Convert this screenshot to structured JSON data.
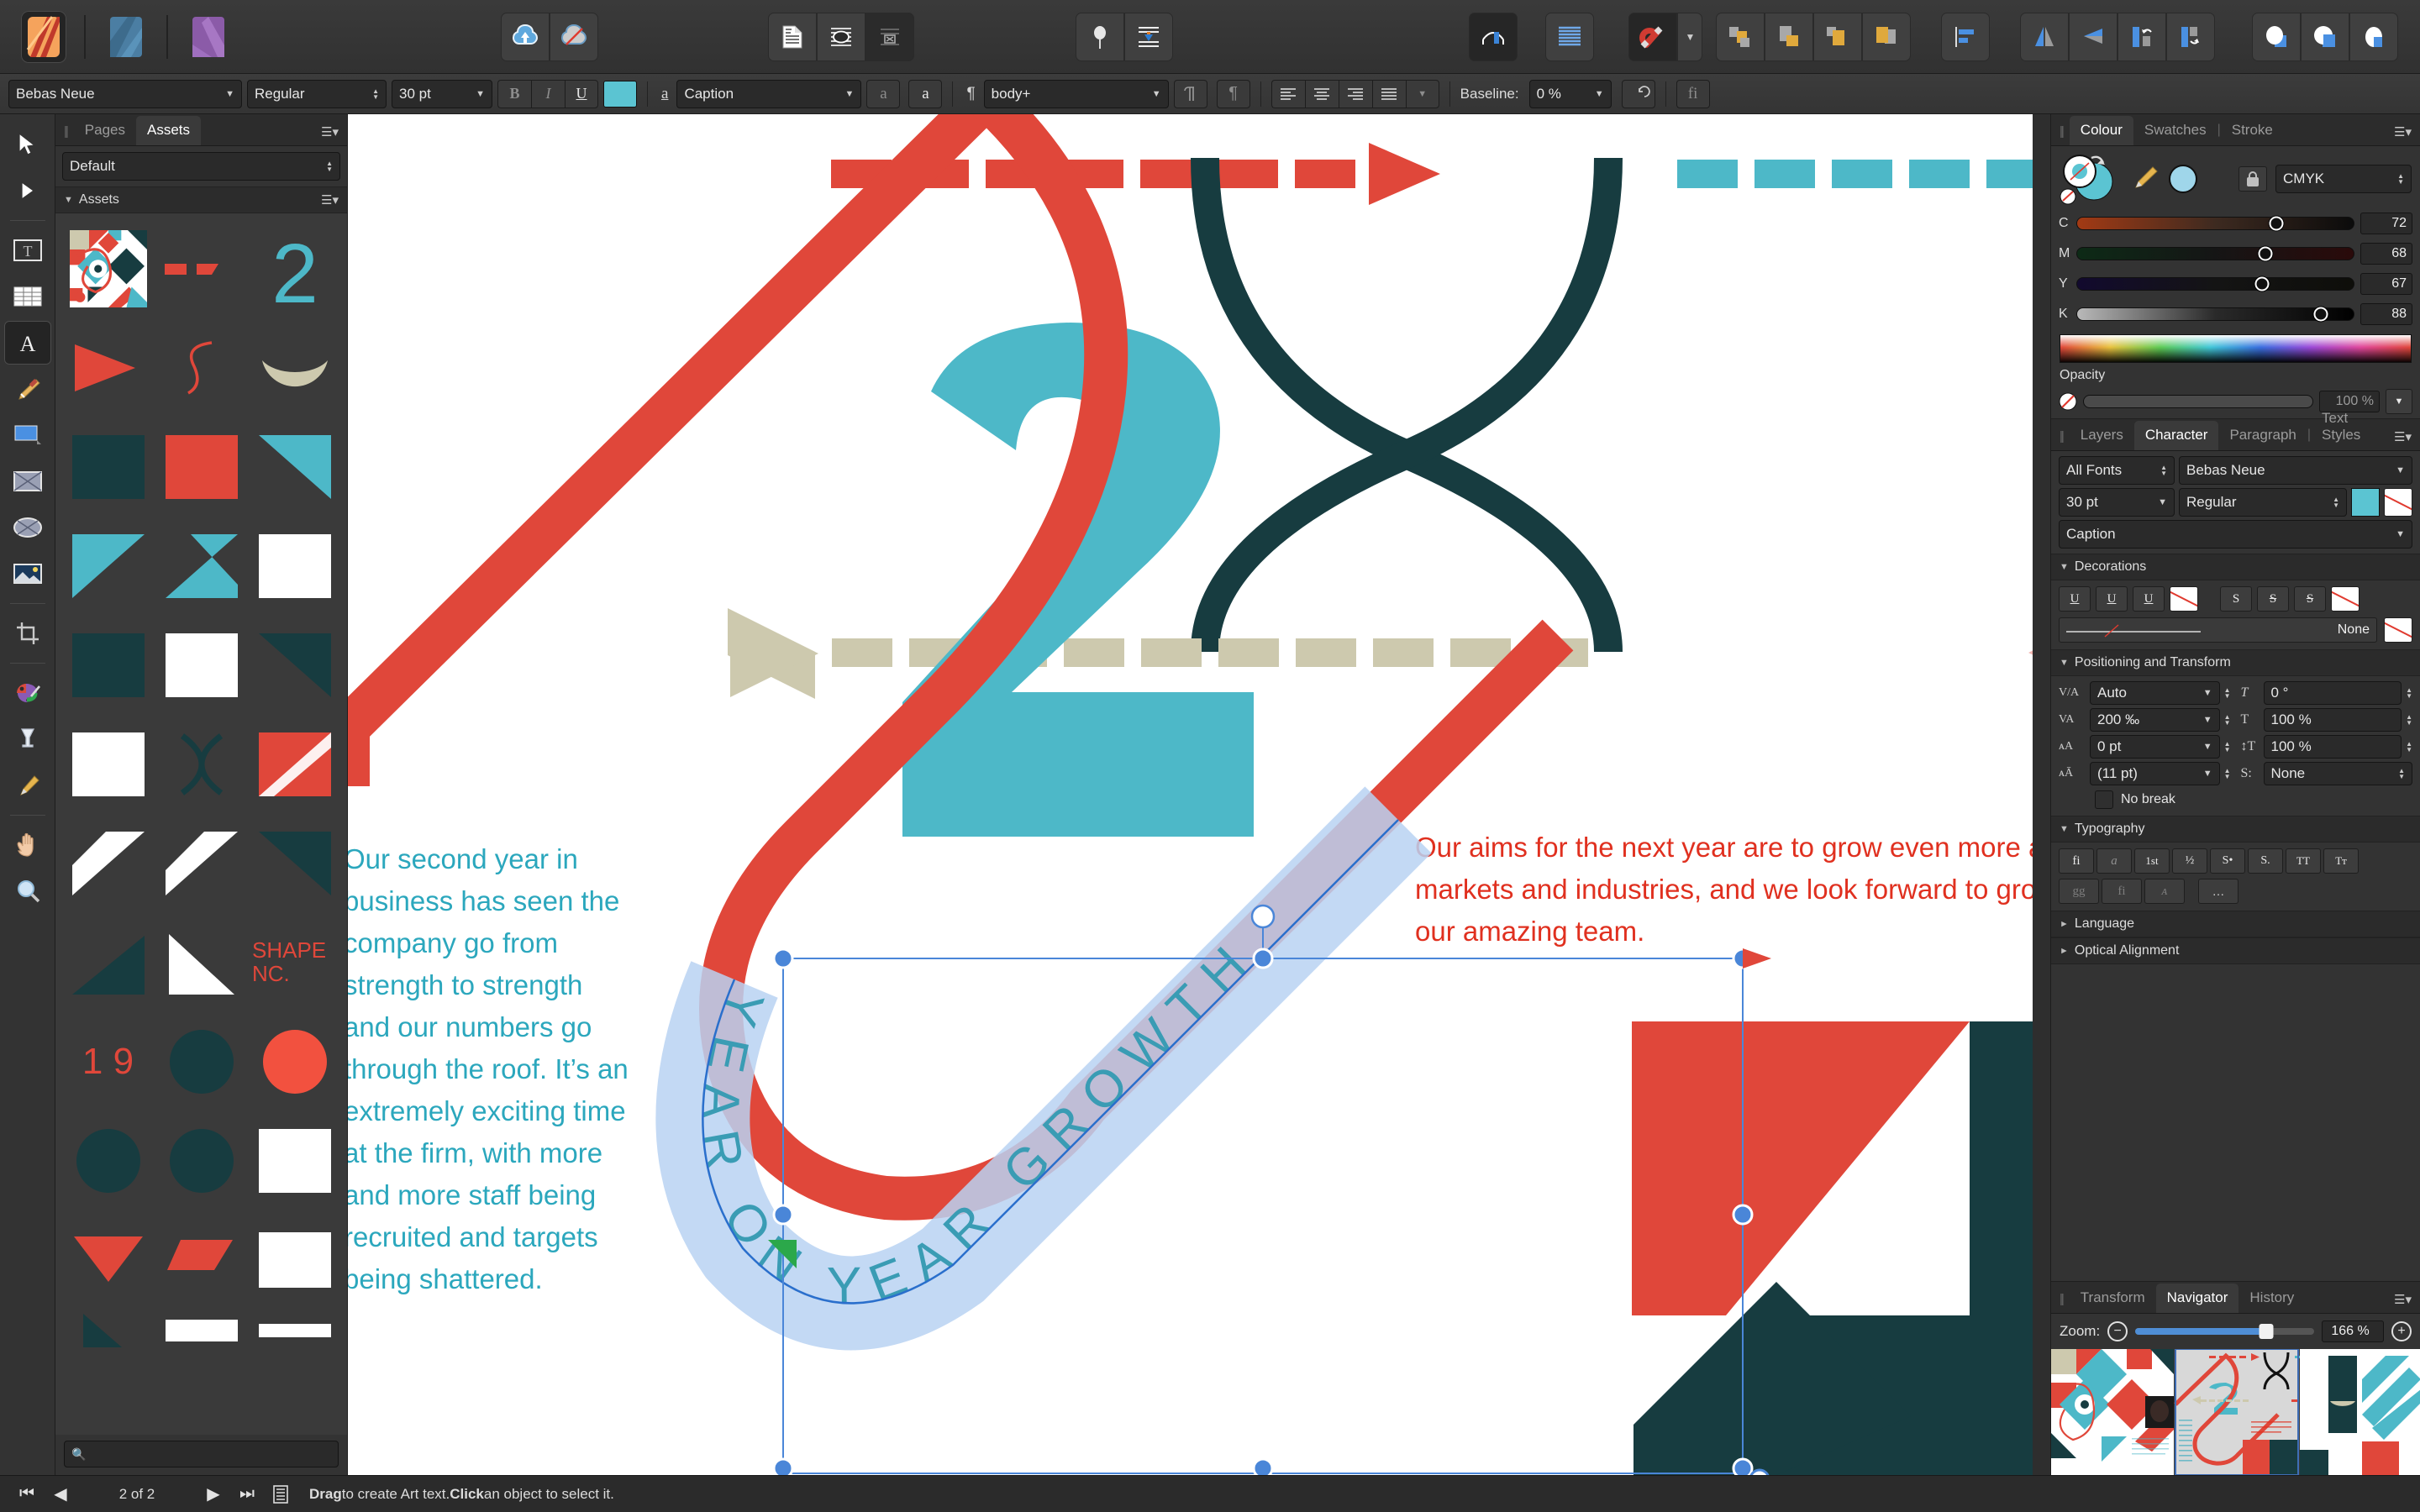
{
  "app": {
    "name": "Affinity Publisher",
    "apps": [
      "publisher-icon",
      "designer-icon",
      "photo-icon"
    ]
  },
  "toolbar": {
    "persona_labels": [
      "publisher-persona",
      "designer-persona",
      "photo-persona"
    ],
    "buttons": [
      {
        "name": "upload-to-cloud",
        "label": "Upload"
      },
      {
        "name": "cloud-disabled",
        "label": "No Cloud"
      },
      {
        "name": "document-setup",
        "label": "Document Setup"
      },
      {
        "name": "preflight",
        "label": "Preflight"
      },
      {
        "name": "stock",
        "label": "Stock"
      },
      {
        "name": "pin-to-text",
        "label": "Pin"
      },
      {
        "name": "text-frame",
        "label": "Text Frame"
      },
      {
        "name": "show-guides",
        "label": "Guides"
      },
      {
        "name": "text-wrap",
        "label": "Text Wrap"
      },
      {
        "name": "snapping",
        "label": "Snapping"
      },
      {
        "name": "move-back-one",
        "label": "Back One"
      },
      {
        "name": "move-to-back",
        "label": "To Back"
      },
      {
        "name": "move-forward-one",
        "label": "Forward One"
      },
      {
        "name": "move-to-front",
        "label": "To Front"
      },
      {
        "name": "alignment",
        "label": "Alignment"
      },
      {
        "name": "flip-horizontal",
        "label": "Flip Horizontal"
      },
      {
        "name": "flip-vertical",
        "label": "Flip Vertical"
      },
      {
        "name": "rotate-left",
        "label": "Rotate Left"
      },
      {
        "name": "rotate-right",
        "label": "Rotate Right"
      },
      {
        "name": "geometry-add",
        "label": "Add"
      },
      {
        "name": "geometry-subtract",
        "label": "Subtract"
      },
      {
        "name": "geometry-intersect",
        "label": "Intersect"
      }
    ]
  },
  "context_bar": {
    "font_family": "Bebas Neue",
    "font_style": "Regular",
    "font_size": "30 pt",
    "bold": "B",
    "italic": "I",
    "underline": "U",
    "text_color": "#5bc4d2",
    "character_style": "Caption",
    "paragraph_style": "body+",
    "baseline_label": "Baseline:",
    "baseline_value": "0 %",
    "glyph_small": "a",
    "glyph_caps": "a",
    "ligature_btn": "fi",
    "pilcrow": "¶"
  },
  "tools": [
    {
      "name": "move-tool",
      "label": "Move"
    },
    {
      "name": "node-tool",
      "label": "Node"
    },
    {
      "name": "frame-text-tool",
      "label": "Frame Text"
    },
    {
      "name": "table-tool",
      "label": "Table"
    },
    {
      "name": "art-text-tool",
      "label": "Art Text"
    },
    {
      "name": "pen-tool",
      "label": "Pen"
    },
    {
      "name": "rectangle-tool",
      "label": "Rectangle"
    },
    {
      "name": "picture-frame-rect-tool",
      "label": "Picture Frame Rectangle"
    },
    {
      "name": "picture-frame-ellipse-tool",
      "label": "Picture Frame Ellipse"
    },
    {
      "name": "place-image-tool",
      "label": "Place Image"
    },
    {
      "name": "crop-tool",
      "label": "Crop"
    },
    {
      "name": "fill-tool",
      "label": "Fill"
    },
    {
      "name": "transparency-tool",
      "label": "Transparency"
    },
    {
      "name": "colour-picker-tool",
      "label": "Colour Picker"
    },
    {
      "name": "view-pan-tool",
      "label": "View"
    },
    {
      "name": "zoom-tool",
      "label": "Zoom"
    }
  ],
  "assets_panel": {
    "tabs": [
      "Pages",
      "Assets"
    ],
    "active_tab": "Assets",
    "category": "Default",
    "section_title": "Assets",
    "search_placeholder": "",
    "items": [
      "pattern-thumbnail",
      "dash-pair-red",
      "numeral-2-teal",
      "triangle-right-red",
      "squiggle-red",
      "crescent-beige",
      "square-teal-dark",
      "square-red",
      "triangle-corner-teal",
      "triangle-teal-left",
      "triangle-teal-right",
      "square-white",
      "square-teal-dark-2",
      "square-white-2",
      "triangle-dark-2",
      "square-white-3",
      "lens-shape-dark",
      "diagonal-red",
      "triangle-white-diag",
      "triangle-white-diag-2",
      "triangle-dark-3",
      "triangle-dark-4",
      "triangle-white-4",
      "text-shape-nc",
      "numerals-1-9",
      "circle-dark",
      "circle-red",
      "circle-dark-2",
      "circle-dark-3",
      "square-white-4",
      "triangle-red-down",
      "parallelogram-red",
      "square-white-5",
      "triangle-teal-small",
      "bar-white",
      "bar-white-2"
    ],
    "shape_text": "SHAPE NC.",
    "numerals_text": "1 9"
  },
  "document": {
    "left_paragraph": "Our second year in business has seen the company go from strength to strength and our numbers go through the roof. It’s an extremely exciting time at the firm, with more and more staff being recruited and targets being shattered.",
    "right_paragraph": "Our aims for the next year are to grow even more and other markets and industries, and we look forward to ground with our amazing team.",
    "art_text": "YEAR ON YEAR GROWTH",
    "numeral_big": "2"
  },
  "colour_panel": {
    "tabs": [
      "Colour",
      "Swatches",
      "Stroke"
    ],
    "active_tab": "Colour",
    "lock_icon": "lock-icon",
    "model": "CMYK",
    "channels": [
      {
        "label": "C",
        "value": "72"
      },
      {
        "label": "M",
        "value": "68"
      },
      {
        "label": "Y",
        "value": "67"
      },
      {
        "label": "K",
        "value": "88"
      }
    ],
    "opacity_label": "Opacity",
    "opacity_value": "100 %"
  },
  "character_panel": {
    "tabs": [
      "Layers",
      "Character",
      "Paragraph",
      "Text Styles"
    ],
    "active_tab": "Character",
    "font_filter": "All Fonts",
    "font_family": "Bebas Neue",
    "font_size": "30 pt",
    "font_style": "Regular",
    "fill_color": "#5bc4d2",
    "stroke_color": "none",
    "text_style": "Caption",
    "decorations": {
      "title": "Decorations",
      "underline_buttons": [
        "U",
        "U",
        "U"
      ],
      "strike_buttons": [
        "S",
        "S",
        "S"
      ],
      "line_value": "None"
    },
    "positioning": {
      "title": "Positioning and Transform",
      "kerning_icon": "V/A",
      "kerning": "Auto",
      "tracking_icon": "VA",
      "tracking": "200 ‰",
      "baseline_icon": "A-baseline",
      "baseline": "0 pt",
      "leading_icon": "A-leading",
      "leading": "(11 pt)",
      "rotation_icon": "T",
      "rotation": "0 °",
      "hscale_icon": "T-horizontal",
      "hscale": "100 %",
      "vscale_icon": "T-vertical",
      "vscale": "100 %",
      "script_label": "S:",
      "script": "None",
      "no_break": "No break"
    },
    "typography": {
      "title": "Typography",
      "buttons": [
        "fi",
        "a",
        "1st",
        "½",
        "S•",
        "S.",
        "TT",
        "Tᴛ"
      ],
      "buttons2": [
        "gg",
        "fi",
        "ᴀ",
        "…"
      ]
    },
    "language": "Language",
    "optical_alignment": "Optical Alignment"
  },
  "navigator_panel": {
    "tabs": [
      "Transform",
      "Navigator",
      "History"
    ],
    "active_tab": "Navigator",
    "zoom_label": "Zoom:",
    "zoom_value": "166 %",
    "minus": "−",
    "plus": "+"
  },
  "status_bar": {
    "page_indicator": "2 of 2",
    "first": "⏮",
    "prev": "◀",
    "next": "▶",
    "last": "⏭",
    "hint_bold_1": "Drag",
    "hint_text_1": " to create Art text. ",
    "hint_bold_2": "Click",
    "hint_text_2": " an object to select it."
  },
  "palette": {
    "red": "#e0473a",
    "teal": "#4db8c8",
    "dark_teal": "#173c40",
    "beige": "#cdc9ae",
    "pink": "#f3b5b0",
    "selection_blue": "#3c7fd0"
  }
}
